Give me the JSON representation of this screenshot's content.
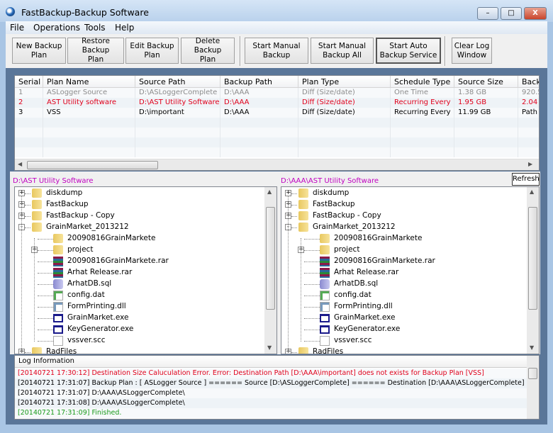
{
  "window": {
    "title": "FastBackup-Backup Software",
    "minimize": "–",
    "maximize": "□",
    "close": "X"
  },
  "menu": [
    "File",
    "Operations",
    "Tools",
    "Help"
  ],
  "toolbar": [
    {
      "label": "New Backup Plan",
      "l1": "New Backup",
      "l2": "Plan"
    },
    {
      "label": "Restore Backup Plan",
      "l1": "Restore Backup",
      "l2": "Plan"
    },
    {
      "label": "Edit Backup Plan",
      "l1": "Edit Backup",
      "l2": "Plan"
    },
    {
      "label": "Delete Backup Plan",
      "l1": "Delete Backup",
      "l2": "Plan"
    },
    {
      "label": "Start Manual Backup",
      "l1": "Start Manual",
      "l2": "Backup"
    },
    {
      "label": "Start Manual Backup All",
      "l1": "Start Manual",
      "l2": "Backup All"
    },
    {
      "label": "Start Auto Backup Service",
      "l1": "Start Auto",
      "l2": "Backup Service"
    },
    {
      "label": "Clear Log Window",
      "l1": "Clear Log",
      "l2": "Window"
    }
  ],
  "grid": {
    "columns": [
      "Serial",
      "Plan Name",
      "Source Path",
      "Backup Path",
      "Plan Type",
      "Schedule Type",
      "Source Size",
      "Back"
    ],
    "rows": [
      {
        "cells": [
          "1",
          "ASLogger Source",
          "D:\\ASLoggerComplete",
          "D:\\AAA",
          "Diff (Size/date)",
          "One Time",
          "1.38 GB",
          "920.5"
        ],
        "color": "#8c8c8c"
      },
      {
        "cells": [
          "2",
          "AST Utility software",
          "D:\\AST Utility Software",
          "D:\\AAA",
          "Diff (Size/date)",
          "Recurring Every",
          "1.95 GB",
          "2.04"
        ],
        "color": "#e0001b"
      },
      {
        "cells": [
          "3",
          "VSS",
          "D:\\important",
          "D:\\AAA",
          "Diff (Size/date)",
          "Recurring Every",
          "11.99 GB",
          "Path"
        ],
        "color": "#000000"
      }
    ]
  },
  "source_pane": {
    "path": "D:\\AST Utility Software"
  },
  "dest_pane": {
    "path": "D:\\AAA\\AST Utility Software",
    "refresh": "Refresh"
  },
  "tree": [
    {
      "name": "diskdump",
      "type": "folder",
      "level": 0,
      "expander": "+"
    },
    {
      "name": "FastBackup",
      "type": "folder",
      "level": 0,
      "expander": "+"
    },
    {
      "name": "FastBackup - Copy",
      "type": "folder",
      "level": 0,
      "expander": "+"
    },
    {
      "name": "GrainMarket_2013212",
      "type": "folder",
      "level": 0,
      "expander": "-"
    },
    {
      "name": "20090816GrainMarkete",
      "type": "folder",
      "level": 1,
      "expander": ""
    },
    {
      "name": "project",
      "type": "folder",
      "level": 1,
      "expander": "+"
    },
    {
      "name": "20090816GrainMarkete.rar",
      "type": "rar",
      "level": 1,
      "expander": ""
    },
    {
      "name": "Arhat Release.rar",
      "type": "rar",
      "level": 1,
      "expander": ""
    },
    {
      "name": "ArhatDB.sql",
      "type": "sql",
      "level": 1,
      "expander": ""
    },
    {
      "name": "config.dat",
      "type": "dat",
      "level": 1,
      "expander": ""
    },
    {
      "name": "FormPrinting.dll",
      "type": "dll",
      "level": 1,
      "expander": ""
    },
    {
      "name": "GrainMarket.exe",
      "type": "exe",
      "level": 1,
      "expander": ""
    },
    {
      "name": "KeyGenerator.exe",
      "type": "exe",
      "level": 1,
      "expander": ""
    },
    {
      "name": "vssver.scc",
      "type": "file",
      "level": 1,
      "expander": ""
    },
    {
      "name": "RadFiles",
      "type": "folder",
      "level": 0,
      "expander": "+"
    }
  ],
  "log": {
    "header": "Log Information",
    "lines": [
      {
        "text": "[20140721 17:30:12] Destination Size Caluculation Error. Error: Destination Path [D:\\AAA\\important] does not exists for Backup Plan [VSS]",
        "color": "#e0001b"
      },
      {
        "text": "[20140721 17:31:07] Backup Plan :  [ ASLogger Source ] ====== Source [D:\\ASLoggerComplete] ====== Destination [D:\\AAA\\ASLoggerComplete]",
        "color": "#000000"
      },
      {
        "text": "[20140721 17:31:07] D:\\AAA\\ASLoggerComplete\\",
        "color": "#000000"
      },
      {
        "text": "[20140721 17:31:08] D:\\AAA\\ASLoggerComplete\\",
        "color": "#000000"
      },
      {
        "text": "[20140721 17:31:09] Finished.",
        "color": "#1a9a1a"
      }
    ]
  }
}
